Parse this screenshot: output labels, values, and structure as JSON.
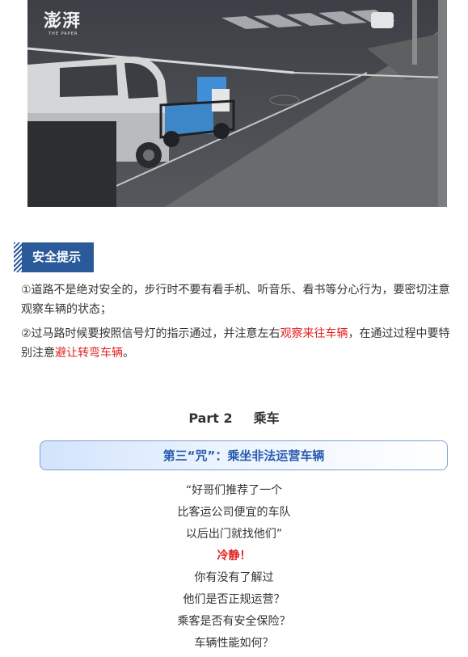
{
  "photo": {
    "watermark": "澎湃",
    "watermark_sub": "THE PAPER"
  },
  "tip": {
    "label": "安全提示"
  },
  "paragraphs": [
    {
      "plain1": "①道路不是绝对安全的，步行时不要有看手机、听音乐、看书等分心行为，要密切注意观察车辆的状态；",
      "red1": "",
      "plain2": "",
      "red2": "",
      "plain3": ""
    },
    {
      "plain1": "②过马路时候要按照信号灯的指示通过，并注意左右",
      "red1": "观察来往车辆",
      "plain2": "，在通过过程中要特别注意",
      "red2": "避让转弯车辆",
      "plain3": "。"
    }
  ],
  "part": {
    "number": "Part 2",
    "name": "乘车"
  },
  "curse": {
    "title": "第三“咒”：乘坐非法运营车辆"
  },
  "quote": {
    "lines": [
      "“好哥们推荐了一个",
      "比客运公司便宜的车队",
      "以后出门就找他们”"
    ],
    "calm": "冷静！",
    "questions": [
      "你有没有了解过",
      "他们是否正规运营？",
      "乘客是否有安全保险？",
      "车辆性能如何？"
    ]
  },
  "colors": {
    "accent_blue": "#2b5a9a",
    "highlight_red": "#e0211f",
    "box_text": "#2b5cb0"
  }
}
